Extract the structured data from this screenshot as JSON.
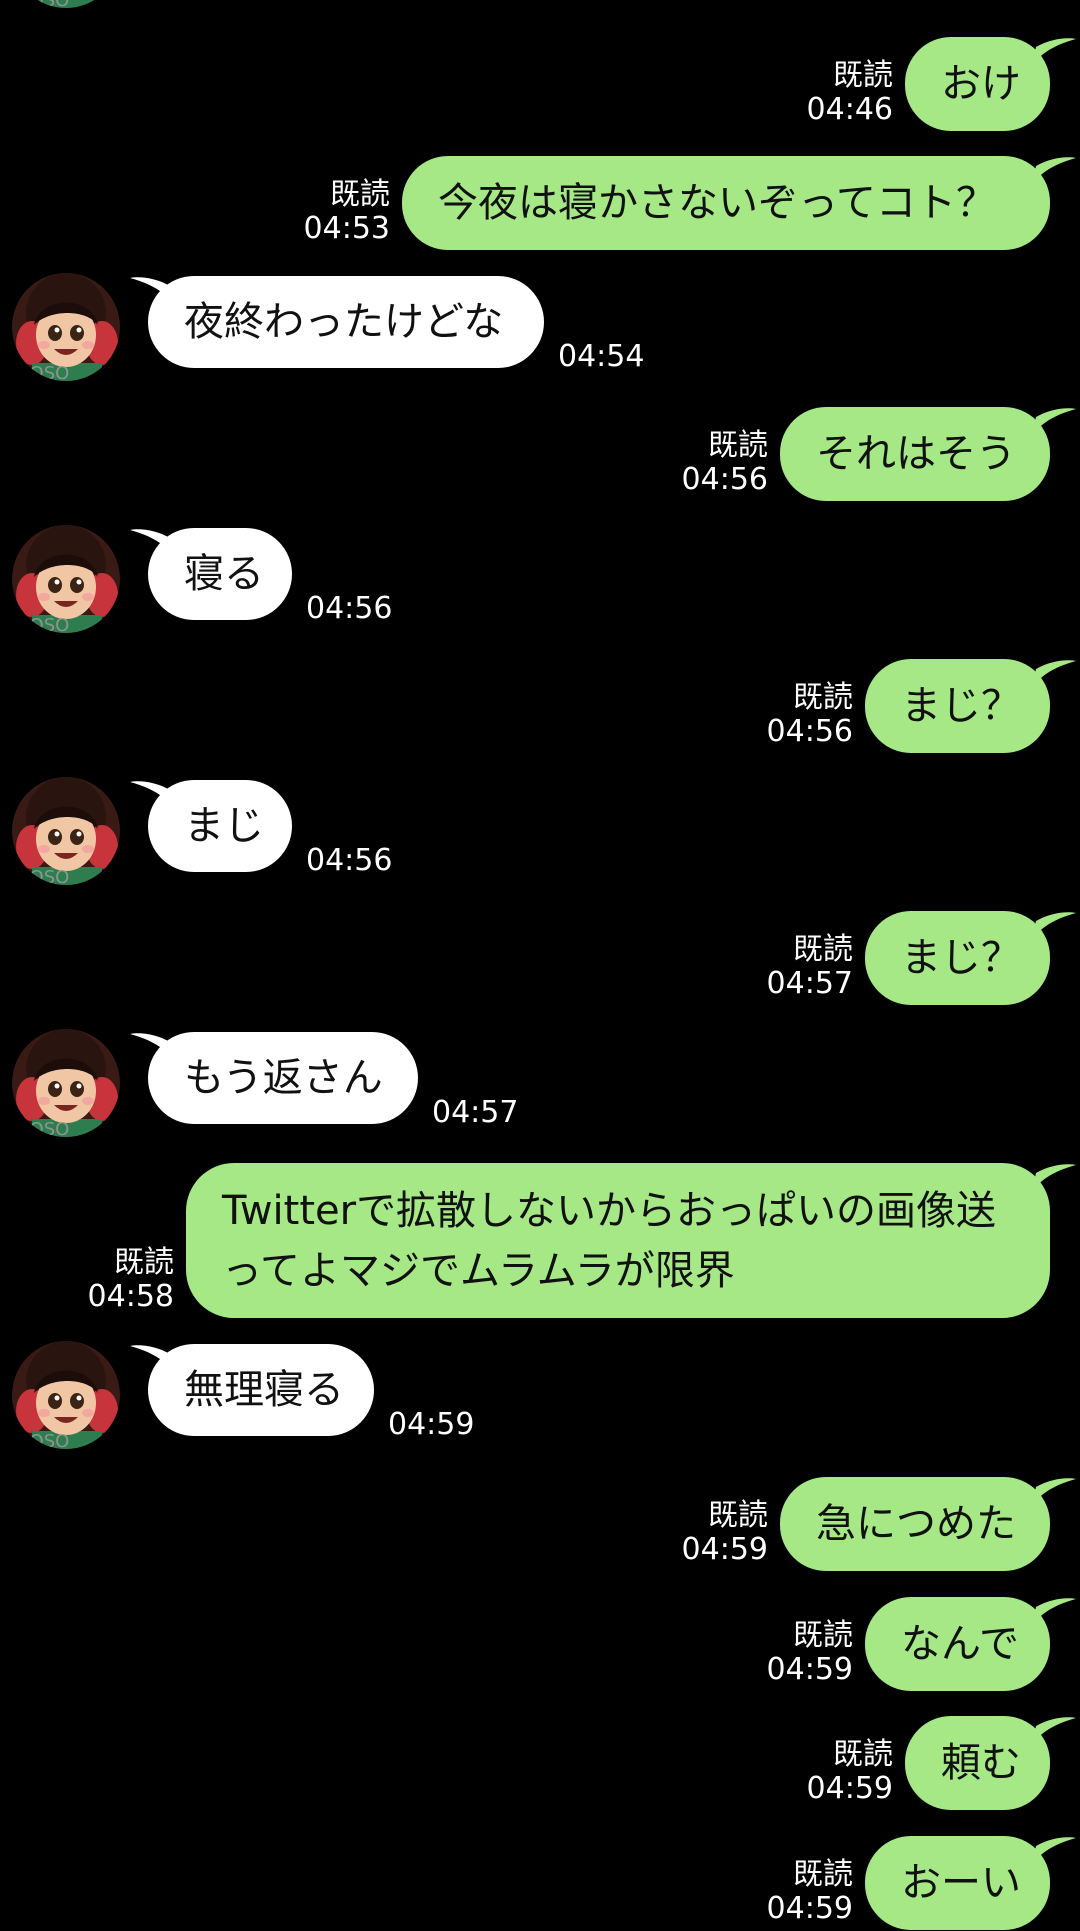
{
  "read_label": "既読",
  "avatar": {
    "watermark": "MOSO"
  },
  "messages": [
    {
      "dir": "out",
      "text": "おけ",
      "time": "04:46"
    },
    {
      "dir": "out",
      "text": "今夜は寝かさないぞってコト？",
      "time": "04:53"
    },
    {
      "dir": "in",
      "text": "夜終わったけどな",
      "time": "04:54"
    },
    {
      "dir": "out",
      "text": "それはそう",
      "time": "04:56"
    },
    {
      "dir": "in",
      "text": "寝る",
      "time": "04:56"
    },
    {
      "dir": "out",
      "text": "まじ？",
      "time": "04:56"
    },
    {
      "dir": "in",
      "text": "まじ",
      "time": "04:56"
    },
    {
      "dir": "out",
      "text": "まじ？",
      "time": "04:57"
    },
    {
      "dir": "in",
      "text": "もう返さん",
      "time": "04:57"
    },
    {
      "dir": "out",
      "text": "Twitterで拡散しないからおっぱいの画像送ってよマジでムラムラが限界",
      "time": "04:58"
    },
    {
      "dir": "in",
      "text": "無理寝る",
      "time": "04:59"
    },
    {
      "dir": "out",
      "text": "急につめた",
      "time": "04:59"
    },
    {
      "dir": "out",
      "text": "なんで",
      "time": "04:59"
    },
    {
      "dir": "out",
      "text": "頼む",
      "time": "04:59"
    },
    {
      "dir": "out",
      "text": "おーい",
      "time": "04:59"
    }
  ],
  "colors": {
    "background": "#000000",
    "outgoing_bubble": "#a5e885",
    "incoming_bubble": "#ffffff",
    "text": "#111111",
    "meta": "#ffffff"
  }
}
